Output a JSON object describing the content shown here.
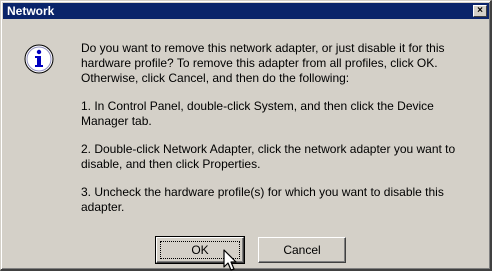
{
  "window": {
    "title": "Network",
    "close_glyph": "×"
  },
  "icon": "info-icon",
  "message": {
    "p1": "Do you want to remove this network adapter, or just disable it for this hardware profile? To remove this adapter from all profiles, click OK. Otherwise, click Cancel, and then do the following:",
    "p2": "1. In Control Panel, double-click System, and then click the Device Manager tab.",
    "p3": "2. Double-click Network Adapter, click the network adapter you want to disable, and then click Properties.",
    "p4": "3. Uncheck the hardware profile(s) for which you want to disable this adapter."
  },
  "buttons": {
    "ok": "OK",
    "cancel": "Cancel"
  },
  "colors": {
    "titlebar": "#0a246a",
    "face": "#d4d0c8"
  }
}
